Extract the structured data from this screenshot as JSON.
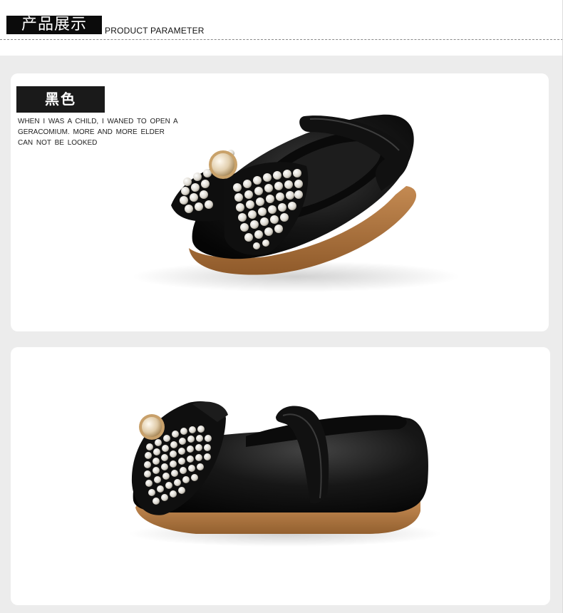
{
  "header": {
    "title": "产品展示",
    "subtitle": "PRODUCT PARAMETER"
  },
  "product": {
    "color_label": "黑色",
    "description_lines": [
      "WHEN I WAS A CHILD, I WANED TO OPEN A",
      "GERACOMIUM. MORE AND MORE ELDER",
      "CAN NOT BE LOOKED"
    ]
  },
  "images": [
    {
      "name": "black-shoe-front-view",
      "accent": "#121212"
    },
    {
      "name": "black-shoe-side-view",
      "accent": "#121212"
    }
  ],
  "colors": {
    "header_bg": "#0b0b0b",
    "panel_bg": "#ececec",
    "card_bg": "#ffffff",
    "shoe_leather": "#121212",
    "sole": "#b5773f",
    "pearl": "#e9e6df"
  }
}
